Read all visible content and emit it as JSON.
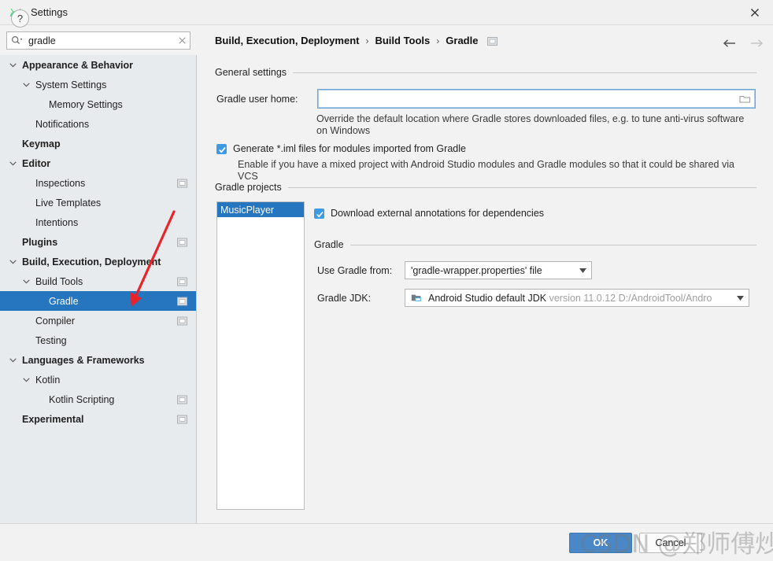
{
  "window": {
    "title": "Settings",
    "logo_icon": "android-logo-icon",
    "close_icon": "close-icon"
  },
  "search": {
    "value": "gradle",
    "placeholder": "",
    "icon": "search-icon",
    "clear_icon": "clear-icon"
  },
  "sidebar": {
    "items": [
      {
        "label": "Appearance & Behavior",
        "indent": 0,
        "bold": true,
        "arrow": "down",
        "badge": false,
        "selected": false
      },
      {
        "label": "System Settings",
        "indent": 1,
        "bold": false,
        "arrow": "down",
        "badge": false,
        "selected": false
      },
      {
        "label": "Memory Settings",
        "indent": 2,
        "bold": false,
        "arrow": "none",
        "badge": false,
        "selected": false
      },
      {
        "label": "Notifications",
        "indent": 1,
        "bold": false,
        "arrow": "none",
        "badge": false,
        "selected": false
      },
      {
        "label": "Keymap",
        "indent": 0,
        "bold": true,
        "arrow": "none",
        "badge": false,
        "selected": false
      },
      {
        "label": "Editor",
        "indent": 0,
        "bold": true,
        "arrow": "down",
        "badge": false,
        "selected": false
      },
      {
        "label": "Inspections",
        "indent": 1,
        "bold": false,
        "arrow": "none",
        "badge": true,
        "selected": false
      },
      {
        "label": "Live Templates",
        "indent": 1,
        "bold": false,
        "arrow": "none",
        "badge": false,
        "selected": false
      },
      {
        "label": "Intentions",
        "indent": 1,
        "bold": false,
        "arrow": "none",
        "badge": false,
        "selected": false
      },
      {
        "label": "Plugins",
        "indent": 0,
        "bold": true,
        "arrow": "none",
        "badge": true,
        "selected": false
      },
      {
        "label": "Build, Execution, Deployment",
        "indent": 0,
        "bold": true,
        "arrow": "down",
        "badge": false,
        "selected": false
      },
      {
        "label": "Build Tools",
        "indent": 1,
        "bold": false,
        "arrow": "down",
        "badge": true,
        "selected": false
      },
      {
        "label": "Gradle",
        "indent": 2,
        "bold": false,
        "arrow": "none",
        "badge": true,
        "selected": true
      },
      {
        "label": "Compiler",
        "indent": 1,
        "bold": false,
        "arrow": "none",
        "badge": true,
        "selected": false
      },
      {
        "label": "Testing",
        "indent": 1,
        "bold": false,
        "arrow": "none",
        "badge": false,
        "selected": false
      },
      {
        "label": "Languages & Frameworks",
        "indent": 0,
        "bold": true,
        "arrow": "down",
        "badge": false,
        "selected": false
      },
      {
        "label": "Kotlin",
        "indent": 1,
        "bold": false,
        "arrow": "down",
        "badge": false,
        "selected": false
      },
      {
        "label": "Kotlin Scripting",
        "indent": 2,
        "bold": false,
        "arrow": "none",
        "badge": true,
        "selected": false
      },
      {
        "label": "Experimental",
        "indent": 0,
        "bold": true,
        "arrow": "none",
        "badge": true,
        "selected": false
      }
    ]
  },
  "breadcrumb": {
    "parts": [
      "Build, Execution, Deployment",
      "Build Tools",
      "Gradle"
    ],
    "separator": "›",
    "badge_icon": "panel-icon",
    "back_icon": "arrow-left-icon",
    "forward_icon": "arrow-right-icon"
  },
  "general_settings": {
    "title": "General settings",
    "gradle_user_home": {
      "label": "Gradle user home:",
      "value": "",
      "browse_icon": "folder-icon"
    },
    "hint": "Override the default location where Gradle stores downloaded files, e.g. to tune anti-virus software on Windows",
    "generate_iml": {
      "label": "Generate *.iml files for modules imported from Gradle",
      "checked": true,
      "hint": "Enable if you have a mixed project with Android Studio modules and Gradle modules so that it could be shared via VCS"
    }
  },
  "gradle_projects": {
    "title": "Gradle projects",
    "list": [
      "MusicPlayer"
    ],
    "selected": "MusicPlayer",
    "download_annotations": {
      "label": "Download external annotations for dependencies",
      "checked": true
    },
    "gradle_group_title": "Gradle",
    "use_gradle_from": {
      "label": "Use Gradle from:",
      "value": "'gradle-wrapper.properties' file"
    },
    "gradle_jdk": {
      "label": "Gradle JDK:",
      "value": "Android Studio default JDK",
      "value_detail": "version 11.0.12 D:/AndroidTool/Andro",
      "icon": "jdk-folder-icon"
    }
  },
  "footer": {
    "help_label": "?",
    "ok_label": "OK",
    "cancel_label": "Cancel"
  },
  "annotations": {
    "watermark_text": "CSDN @郑师傅炒板栗",
    "arrow_color": "#e8242a"
  },
  "colors": {
    "accent": "#2675bf",
    "checkbox": "#3f9ae4",
    "ok_button": "#4a87c6",
    "field_focus": "#6ba5d6",
    "sidebar_bg": "#e8ebed"
  }
}
